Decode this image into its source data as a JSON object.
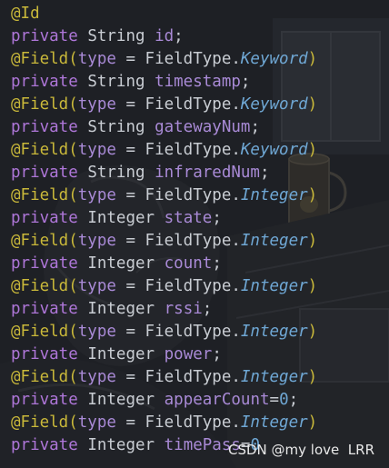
{
  "editor": {
    "lines": [
      {
        "kind": "annotation-id",
        "text": "@Id"
      },
      {
        "kind": "decl",
        "kw": "private",
        "type": "String",
        "name": "id",
        "tail": ";"
      },
      {
        "kind": "field",
        "at": "@Field",
        "open": "(",
        "param": "type",
        "eq": " = FieldType.",
        "value": "Keyword",
        "close": ")"
      },
      {
        "kind": "decl",
        "kw": "private",
        "type": "String",
        "name": "timestamp",
        "tail": ";"
      },
      {
        "kind": "field",
        "at": "@Field",
        "open": "(",
        "param": "type",
        "eq": " = FieldType.",
        "value": "Keyword",
        "close": ")"
      },
      {
        "kind": "decl",
        "kw": "private",
        "type": "String",
        "name": "gatewayNum",
        "tail": ";"
      },
      {
        "kind": "field",
        "at": "@Field",
        "open": "(",
        "param": "type",
        "eq": " = FieldType.",
        "value": "Keyword",
        "close": ")"
      },
      {
        "kind": "decl",
        "kw": "private",
        "type": "String",
        "name": "infraredNum",
        "tail": ";"
      },
      {
        "kind": "field",
        "at": "@Field",
        "open": "(",
        "param": "type",
        "eq": " = FieldType.",
        "value": "Integer",
        "close": ")"
      },
      {
        "kind": "decl",
        "kw": "private",
        "type": "Integer",
        "name": "state",
        "tail": ";"
      },
      {
        "kind": "field",
        "at": "@Field",
        "open": "(",
        "param": "type",
        "eq": " = FieldType.",
        "value": "Integer",
        "close": ")"
      },
      {
        "kind": "decl",
        "kw": "private",
        "type": "Integer",
        "name": "count",
        "tail": ";"
      },
      {
        "kind": "field",
        "at": "@Field",
        "open": "(",
        "param": "type",
        "eq": " = FieldType.",
        "value": "Integer",
        "close": ")"
      },
      {
        "kind": "decl",
        "kw": "private",
        "type": "Integer",
        "name": "rssi",
        "tail": ";"
      },
      {
        "kind": "field",
        "at": "@Field",
        "open": "(",
        "param": "type",
        "eq": " = FieldType.",
        "value": "Integer",
        "close": ")"
      },
      {
        "kind": "decl",
        "kw": "private",
        "type": "Integer",
        "name": "power",
        "tail": ";"
      },
      {
        "kind": "field",
        "at": "@Field",
        "open": "(",
        "param": "type",
        "eq": " = FieldType.",
        "value": "Integer",
        "close": ")"
      },
      {
        "kind": "decl-init",
        "kw": "private",
        "type": "Integer",
        "name": "appearCount",
        "eqsign": "=",
        "num": "0",
        "tail": ";"
      },
      {
        "kind": "field",
        "at": "@Field",
        "open": "(",
        "param": "type",
        "eq": " = FieldType.",
        "value": "Integer",
        "close": ")"
      },
      {
        "kind": "decl-init",
        "kw": "private",
        "type": "Integer",
        "name": "timePass",
        "eqsign": "=",
        "num": "0",
        "tail": ""
      }
    ]
  },
  "watermark": "CSDN @my love  LRR",
  "colors": {
    "background": "#1f2126",
    "annotation": "#c9b83a",
    "keyword": "#ae76d8",
    "field_name": "#a98ad6",
    "enum_value": "#6fa7d4",
    "text": "#c9cdd3"
  }
}
